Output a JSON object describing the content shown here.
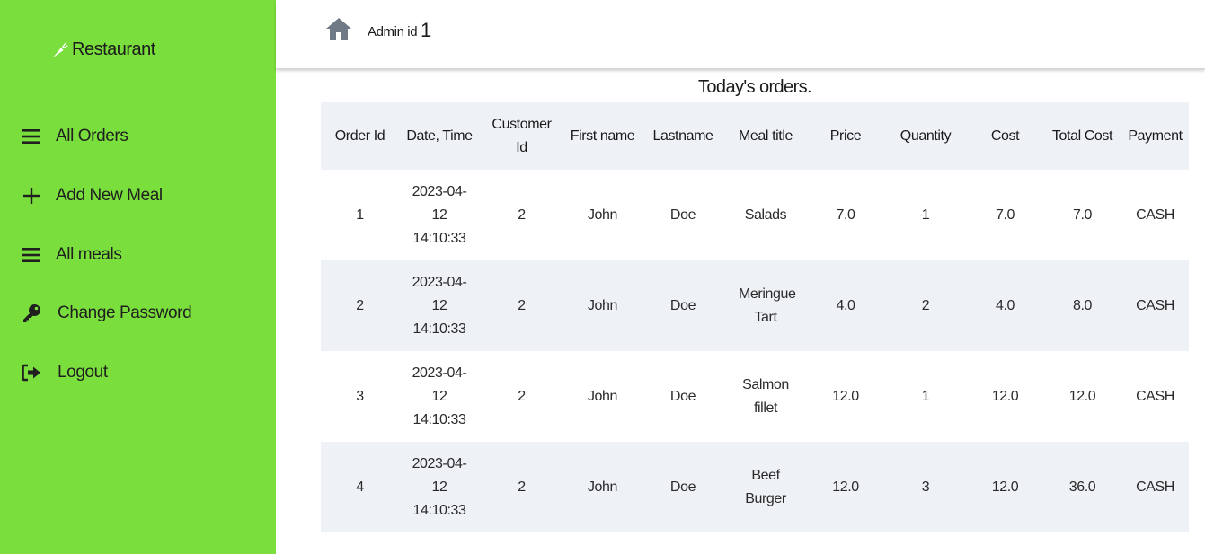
{
  "brand": {
    "name": "Restaurant",
    "icon": "carrot-icon"
  },
  "nav": {
    "items": [
      {
        "label": "All Orders",
        "icon": "bars-icon"
      },
      {
        "label": "Add New Meal",
        "icon": "plus-icon"
      },
      {
        "label": "All meals",
        "icon": "bars-icon"
      },
      {
        "label": "Change Password",
        "icon": "key-icon"
      },
      {
        "label": "Logout",
        "icon": "logout-icon"
      }
    ]
  },
  "header": {
    "admin_label": "Admin id",
    "admin_id": "1",
    "home_icon": "home-icon"
  },
  "orders": {
    "caption": "Today's orders.",
    "columns": [
      "Order Id",
      "Date, Time",
      "Customer Id",
      "First name",
      "Lastname",
      "Meal title",
      "Price",
      "Quantity",
      "Cost",
      "Total Cost",
      "Payment"
    ],
    "rows": [
      {
        "order_id": "1",
        "datetime": "2023-04-12 14:10:33",
        "customer_id": "2",
        "first_name": "John",
        "last_name": "Doe",
        "meal": "Salads",
        "price": "7.0",
        "quantity": "1",
        "cost": "7.0",
        "total": "7.0",
        "payment": "CASH"
      },
      {
        "order_id": "2",
        "datetime": "2023-04-12 14:10:33",
        "customer_id": "2",
        "first_name": "John",
        "last_name": "Doe",
        "meal": "Meringue Tart",
        "price": "4.0",
        "quantity": "2",
        "cost": "4.0",
        "total": "8.0",
        "payment": "CASH"
      },
      {
        "order_id": "3",
        "datetime": "2023-04-12 14:10:33",
        "customer_id": "2",
        "first_name": "John",
        "last_name": "Doe",
        "meal": "Salmon fillet",
        "price": "12.0",
        "quantity": "1",
        "cost": "12.0",
        "total": "12.0",
        "payment": "CASH"
      },
      {
        "order_id": "4",
        "datetime": "2023-04-12 14:10:33",
        "customer_id": "2",
        "first_name": "John",
        "last_name": "Doe",
        "meal": "Beef Burger",
        "price": "12.0",
        "quantity": "3",
        "cost": "12.0",
        "total": "36.0",
        "payment": "CASH"
      }
    ]
  },
  "colors": {
    "sidebar": "#7ade3c",
    "row_alt": "#eef2f6",
    "home_icon": "#6f7a86"
  }
}
